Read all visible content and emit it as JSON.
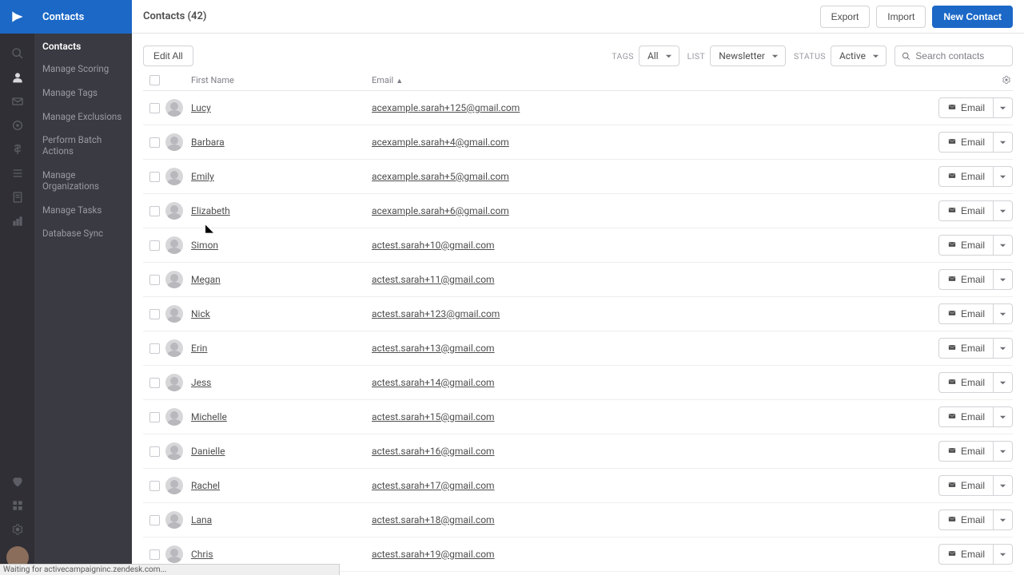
{
  "sidenav": {
    "header": "Contacts",
    "subheader": "Contacts",
    "items": [
      "Manage Scoring",
      "Manage Tags",
      "Manage Exclusions",
      "Perform Batch Actions",
      "Manage Organizations",
      "Manage Tasks",
      "Database Sync"
    ]
  },
  "topbar": {
    "title": "Contacts (42)",
    "export": "Export",
    "import": "Import",
    "new_contact": "New Contact"
  },
  "filterbar": {
    "edit_all": "Edit All",
    "tags_label": "TAGS",
    "tags_value": "All",
    "list_label": "LIST",
    "list_value": "Newsletter",
    "status_label": "STATUS",
    "status_value": "Active",
    "search_placeholder": "Search contacts"
  },
  "table": {
    "col_first_name": "First Name",
    "col_email": "Email",
    "sort_arrow": "▲",
    "email_btn": "Email",
    "rows": [
      {
        "name": "Lucy",
        "email": "acexample.sarah+125@gmail.com"
      },
      {
        "name": "Barbara",
        "email": "acexample.sarah+4@gmail.com"
      },
      {
        "name": "Emily",
        "email": "acexample.sarah+5@gmail.com"
      },
      {
        "name": "Elizabeth",
        "email": "acexample.sarah+6@gmail.com"
      },
      {
        "name": "Simon",
        "email": "actest.sarah+10@gmail.com"
      },
      {
        "name": "Megan",
        "email": "actest.sarah+11@gmail.com"
      },
      {
        "name": "Nick",
        "email": "actest.sarah+123@gmail.com"
      },
      {
        "name": "Erin",
        "email": "actest.sarah+13@gmail.com"
      },
      {
        "name": "Jess",
        "email": "actest.sarah+14@gmail.com"
      },
      {
        "name": "Michelle",
        "email": "actest.sarah+15@gmail.com"
      },
      {
        "name": "Danielle",
        "email": "actest.sarah+16@gmail.com"
      },
      {
        "name": "Rachel",
        "email": "actest.sarah+17@gmail.com"
      },
      {
        "name": "Lana",
        "email": "actest.sarah+18@gmail.com"
      },
      {
        "name": "Chris",
        "email": "actest.sarah+19@gmail.com"
      }
    ]
  },
  "status_text": "Waiting for activecampaigninc.zendesk.com...",
  "colors": {
    "brand_blue": "#1b68c7",
    "rail_bg": "#2f2f35",
    "sidenav_bg": "#3a3a42"
  }
}
